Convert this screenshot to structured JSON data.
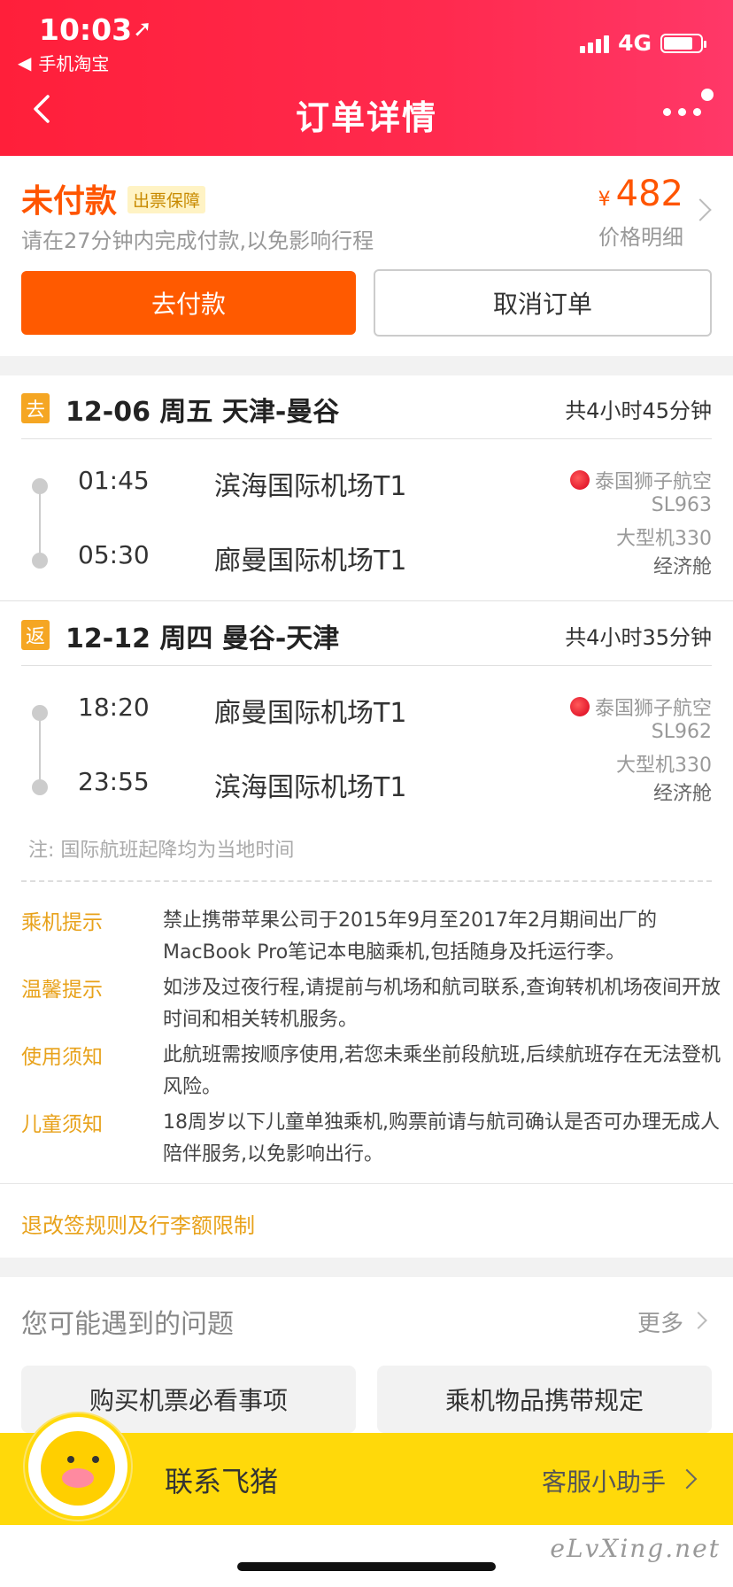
{
  "status_bar": {
    "time": "10:03",
    "back_app": "手机淘宝",
    "network": "4G",
    "battery_level": 0.8
  },
  "nav": {
    "title": "订单详情"
  },
  "order_status": {
    "title": "未付款",
    "badge": "出票保障",
    "countdown": "请在27分钟内完成付款,以免影响行程",
    "currency": "¥",
    "price": "482",
    "price_detail": "价格明细",
    "pay_label": "去付款",
    "cancel_label": "取消订单"
  },
  "segments": [
    {
      "tag": "去",
      "title": "12-06 周五 天津-曼谷",
      "duration": "共4小时45分钟",
      "depart_time": "01:45",
      "depart_airport": "滨海国际机场T1",
      "arrive_time": "05:30",
      "arrive_airport": "廊曼国际机场T1",
      "airline": "泰国狮子航空",
      "flight_no": "SL963",
      "aircraft": "大型机330",
      "cabin": "经济舱"
    },
    {
      "tag": "返",
      "title": "12-12 周四 曼谷-天津",
      "duration": "共4小时35分钟",
      "depart_time": "18:20",
      "depart_airport": "廊曼国际机场T1",
      "arrive_time": "23:55",
      "arrive_airport": "滨海国际机场T1",
      "airline": "泰国狮子航空",
      "flight_no": "SL962",
      "aircraft": "大型机330",
      "cabin": "经济舱"
    }
  ],
  "note": "注: 国际航班起降均为当地时间",
  "tips": [
    {
      "label": "乘机提示",
      "text": "禁止携带苹果公司于2015年9月至2017年2月期间出厂的MacBook Pro笔记本电脑乘机,包括随身及托运行李。"
    },
    {
      "label": "温馨提示",
      "text": "如涉及过夜行程,请提前与机场和航司联系,查询转机机场夜间开放时间和相关转机服务。"
    },
    {
      "label": "使用须知",
      "text": "此航班需按顺序使用,若您未乘坐前段航班,后续航班存在无法登机风险。"
    },
    {
      "label": "儿童须知",
      "text": "18周岁以下儿童单独乘机,购票前请与航司确认是否可办理无成人陪伴服务,以免影响出行。"
    }
  ],
  "rules_link": "退改签规则及行李额限制",
  "faq": {
    "title": "您可能遇到的问题",
    "more": "更多",
    "buttons": [
      "购买机票必看事项",
      "乘机物品携带规定"
    ]
  },
  "contact": {
    "label": "联系飞猪",
    "assistant": "客服小助手"
  },
  "watermark": "eLvXing.net",
  "colors": {
    "header_red": "#ff2a4e",
    "accent_orange": "#ff5a00",
    "tip_gold": "#e8a21b",
    "contact_yellow": "#ffd90a"
  }
}
